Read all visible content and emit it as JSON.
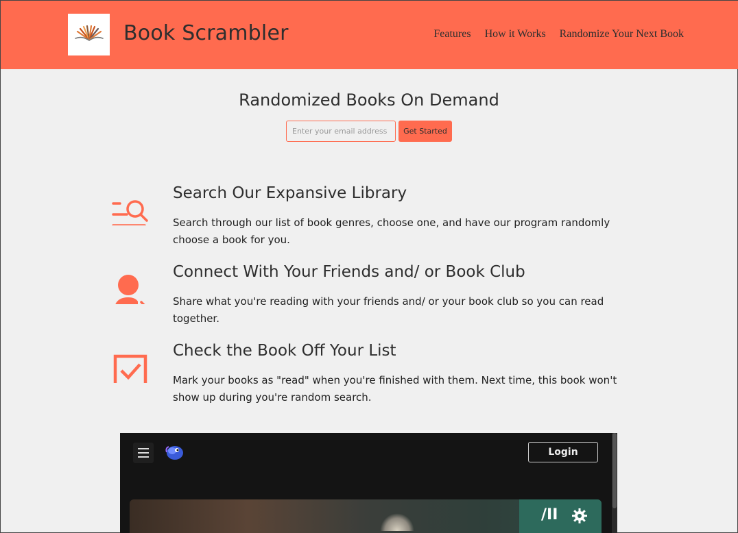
{
  "header": {
    "brand": "Book Scrambler",
    "nav": [
      "Features",
      "How it Works",
      "Randomize Your Next Book"
    ]
  },
  "hero": {
    "title": "Randomized Books On Demand",
    "email_placeholder": "Enter your email address",
    "cta_label": "Get Started"
  },
  "features": [
    {
      "icon": "search-list-icon",
      "title": "Search Our Expansive Library",
      "text": "Search through our list of book genres, choose one, and have our program randomly choose a book for you."
    },
    {
      "icon": "user-share-icon",
      "title": "Connect With Your Friends and/ or Book Club",
      "text": "Share what you're reading with your friends and/ or your book club so you can read together."
    },
    {
      "icon": "checkbox-checked-icon",
      "title": "Check the Book Off Your List",
      "text": "Mark your books as \"read\" when you're finished with them. Next time, this book won't show up during you're random search."
    }
  ],
  "embed": {
    "login_label": "Login",
    "controls_label": "/II"
  },
  "colors": {
    "accent": "#ff6b4f",
    "background": "#f0f0f0",
    "embed_bg": "#141414"
  }
}
